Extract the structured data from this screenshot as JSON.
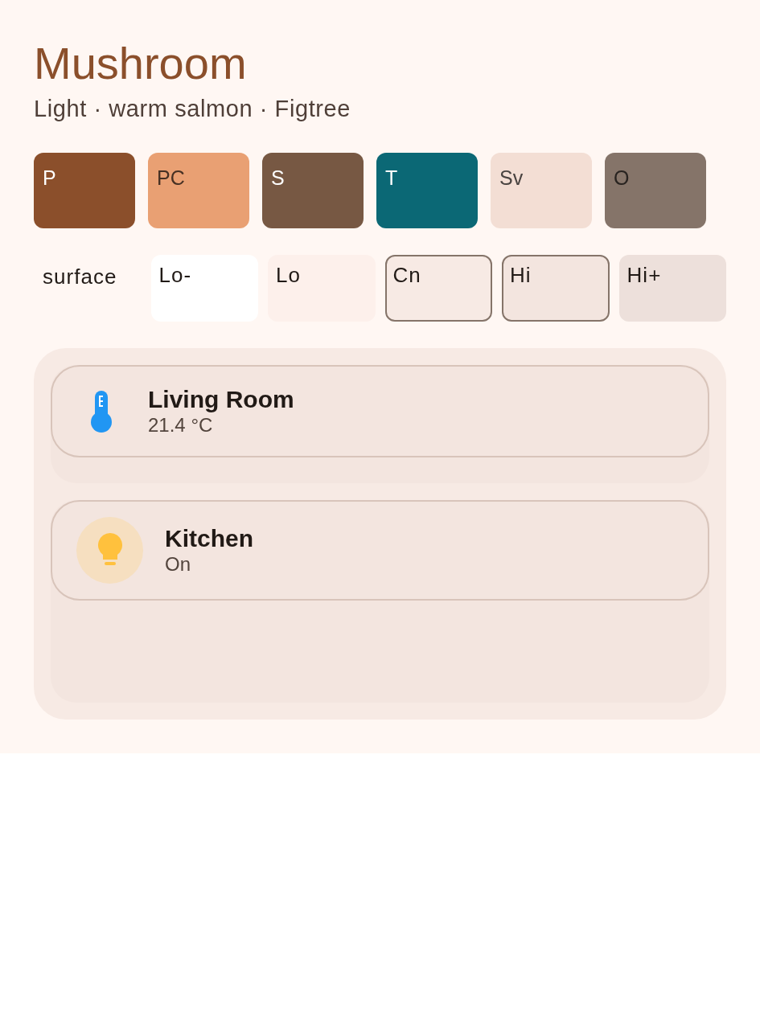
{
  "title": "Mushroom",
  "subtitle": "Light · warm salmon · Figtree",
  "swatches": [
    {
      "label": "P",
      "color": "#8b4f2b"
    },
    {
      "label": "PC",
      "color": "#e9a073"
    },
    {
      "label": "S",
      "color": "#775843"
    },
    {
      "label": "T",
      "color": "#0b6875"
    },
    {
      "label": "Sv",
      "color": "#f3ded4"
    },
    {
      "label": "O",
      "color": "#857469"
    }
  ],
  "surface": {
    "label": "surface",
    "tiles": [
      {
        "label": "Lo-",
        "color": "#ffffff",
        "highlighted": false
      },
      {
        "label": "Lo",
        "color": "#fdf0eb",
        "highlighted": false
      },
      {
        "label": "Cn",
        "color": "#f7eae4",
        "highlighted": true
      },
      {
        "label": "Hi",
        "color": "#f3e5df",
        "highlighted": true
      },
      {
        "label": "Hi+",
        "color": "#ede0db",
        "highlighted": false
      }
    ]
  },
  "cards": [
    {
      "kind": "sensor",
      "name": "Living Room",
      "state": "21.4 °C"
    },
    {
      "kind": "light",
      "name": "Kitchen",
      "state": "On",
      "on": true
    }
  ]
}
